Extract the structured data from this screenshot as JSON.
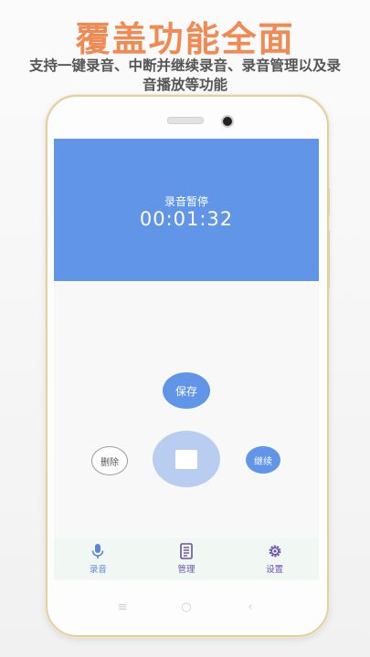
{
  "promo": {
    "title": "覆盖功能全面",
    "subtitle": "支持一键录音、中断并继续录音、录音管理以及录音播放等功能"
  },
  "recorder": {
    "status": "录音暂停",
    "timer": "00:01:32",
    "save_label": "保存",
    "delete_label": "删除",
    "continue_label": "继续",
    "primary_color": "#6195e8"
  },
  "nav": {
    "items": [
      {
        "label": "录音",
        "icon": "microphone-icon"
      },
      {
        "label": "管理",
        "icon": "document-icon"
      },
      {
        "label": "设置",
        "icon": "gear-icon"
      }
    ]
  },
  "system_nav": {
    "menu_glyph": "≡",
    "home_glyph": "○",
    "back_glyph": "‹"
  }
}
